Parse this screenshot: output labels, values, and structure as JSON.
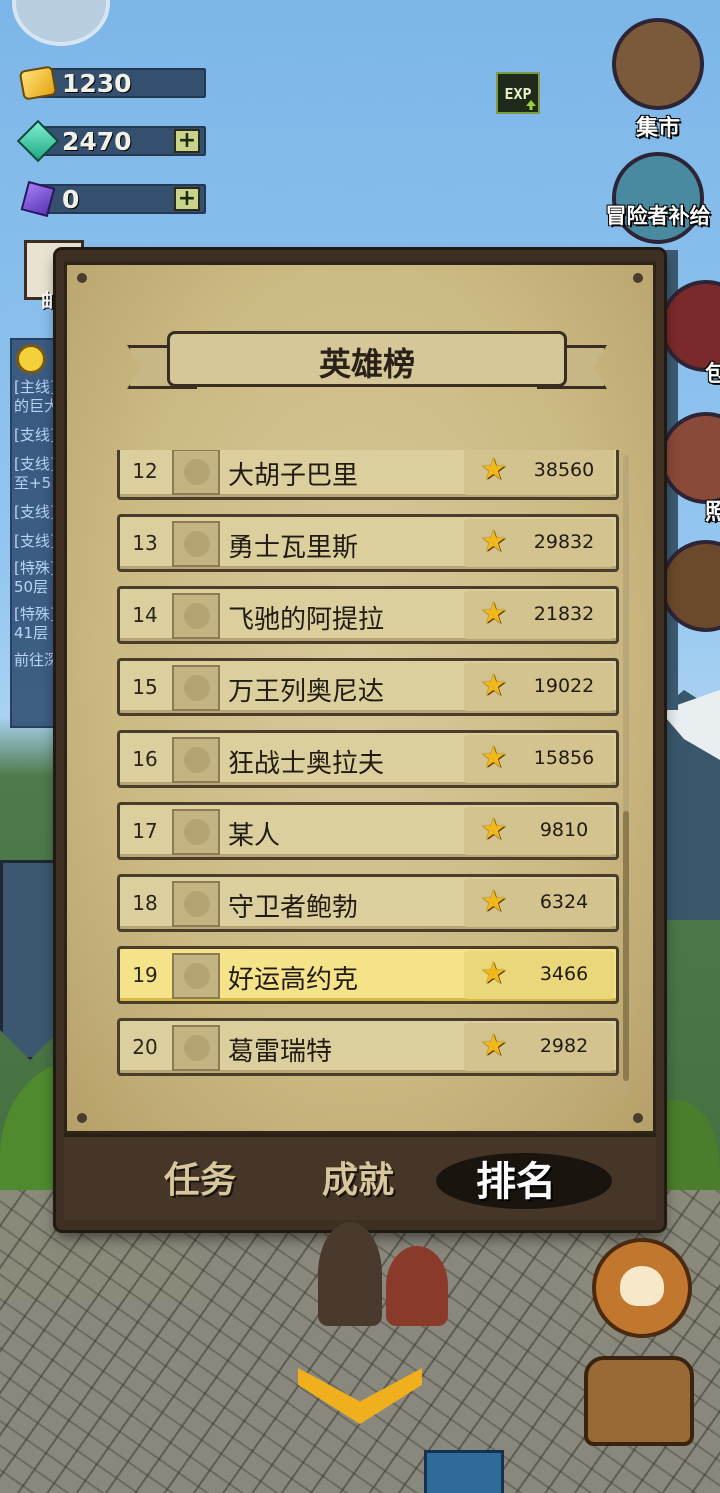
{
  "resources": [
    {
      "icon": "gold-icon",
      "value": "1230",
      "has_plus": false
    },
    {
      "icon": "gem-icon",
      "value": "2470",
      "has_plus": true
    },
    {
      "icon": "scroll-icon",
      "value": "0",
      "has_plus": true
    }
  ],
  "plus_label": "+",
  "exp_label": "EXP",
  "mail_label": "邮",
  "side_buttons": {
    "market": "集市",
    "adventurer_supply": "冒险者补给",
    "gift": "包",
    "photo": "照"
  },
  "quest_tracker": [
    "[主线]",
    "的巨大",
    "[支线]",
    "[支线]",
    "至+5",
    "[支线]",
    "[支线]",
    "[特殊]",
    "50层",
    "[特殊]",
    "41层",
    "前往深"
  ],
  "panel": {
    "title": "英雄榜",
    "rows": [
      {
        "rank": "12",
        "name": "大胡子巴里",
        "score": "38560",
        "highlight": false
      },
      {
        "rank": "13",
        "name": "勇士瓦里斯",
        "score": "29832",
        "highlight": false
      },
      {
        "rank": "14",
        "name": "飞驰的阿提拉",
        "score": "21832",
        "highlight": false
      },
      {
        "rank": "15",
        "name": "万王列奥尼达",
        "score": "19022",
        "highlight": false
      },
      {
        "rank": "16",
        "name": "狂战士奥拉夫",
        "score": "15856",
        "highlight": false
      },
      {
        "rank": "17",
        "name": "某人",
        "score": "9810",
        "highlight": false
      },
      {
        "rank": "18",
        "name": "守卫者鲍勃",
        "score": "6324",
        "highlight": false
      },
      {
        "rank": "19",
        "name": "好运高约克",
        "score": "3466",
        "highlight": true
      },
      {
        "rank": "20",
        "name": "葛雷瑞特",
        "score": "2982",
        "highlight": false
      }
    ],
    "tabs": [
      {
        "label": "任务",
        "active": false
      },
      {
        "label": "成就",
        "active": false
      },
      {
        "label": "排名",
        "active": true
      }
    ]
  },
  "colors": {
    "highlight_row": "#f5e38a",
    "star": "#f1b81c",
    "parchment": "#cbb982"
  }
}
